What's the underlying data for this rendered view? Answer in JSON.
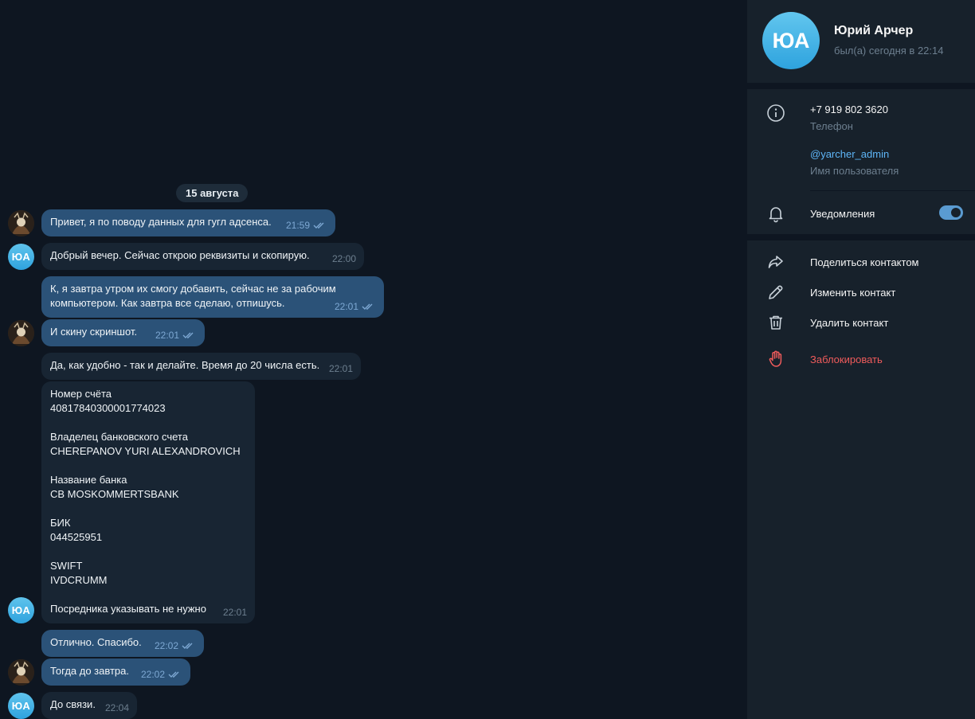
{
  "chat": {
    "date_pill": "15 августа",
    "messages": [
      {
        "text": "Привет, я по поводу данных для гугл адсенса.",
        "time": "21:59"
      },
      {
        "text": "Добрый вечер. Сейчас открою реквизиты и скопирую.",
        "time": "22:00"
      },
      {
        "text": "К, я завтра утром их смогу добавить, сейчас не за рабочим\nкомпьютером. Как завтра все сделаю, отпишусь.",
        "time": "22:01"
      },
      {
        "text": "И скину скриншот.",
        "time": "22:01"
      },
      {
        "text": "Да, как удобно - так и делайте. Время до 20 числа есть.",
        "time": "22:01"
      },
      {
        "text": "Номер счёта\n40817840300001774023\n\nВладелец банковского счета\nCHEREPANOV YURI ALEXANDROVICH\n\nНазвание банка\nCB MOSKOMMERTSBANK\n\nБИК\n044525951\n\nSWIFT\nIVDCRUMM\n\nПосредника указывать не нужно",
        "time": "22:01"
      },
      {
        "text": "Отлично. Спасибо.",
        "time": "22:02"
      },
      {
        "text": "Тогда до завтра.",
        "time": "22:02"
      },
      {
        "text": "До связи.",
        "time": "22:04"
      }
    ],
    "avatar_initials": "ЮА"
  },
  "profile": {
    "initials": "ЮА",
    "name": "Юрий Арчер",
    "status": "был(а) сегодня в 22:14",
    "phone": "+7 919 802 3620",
    "phone_label": "Телефон",
    "username": "@yarcher_admin",
    "username_label": "Имя пользователя",
    "notifications_label": "Уведомления",
    "notifications_on": true
  },
  "actions": {
    "share": "Поделиться контактом",
    "edit": "Изменить контакт",
    "delete": "Удалить контакт",
    "block": "Заблокировать"
  },
  "colors": {
    "background": "#0e1621",
    "sidebar": "#17212b",
    "outgoing_bubble": "#2b5278",
    "incoming_bubble": "#182533",
    "link": "#5eb5f7",
    "danger": "#ef5b5b"
  },
  "icons": {
    "info": "info-icon",
    "bell": "bell-icon",
    "share": "share-icon",
    "edit": "pencil-icon",
    "delete": "trash-icon",
    "block": "hand-icon",
    "read": "double-check-icon"
  }
}
